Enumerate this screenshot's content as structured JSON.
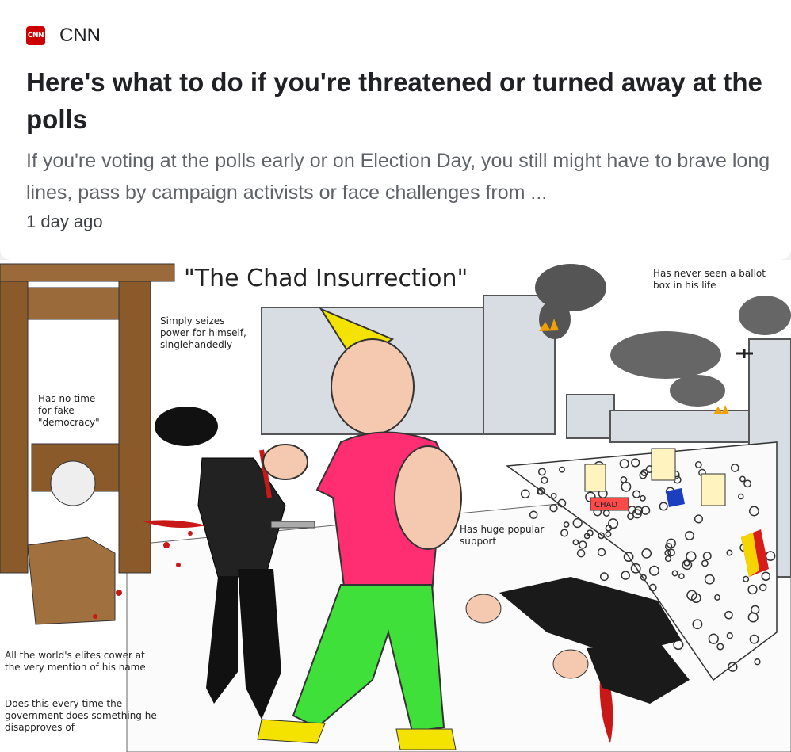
{
  "article": {
    "source": "CNN",
    "source_logo_text": "CNN",
    "headline": "Here's what to do if you're threatened or turned away at the polls",
    "snippet": "If you're voting at the polls early or on Election Day, you still might have to brave long lines, pass by campaign activists or face challenges from ...",
    "time": "1 day ago"
  },
  "meme": {
    "title": "\"The Chad Insurrection\"",
    "captions": {
      "ballot": "Has never seen a ballot\nbox in his life",
      "seizes": "Simply seizes\npower for himself,\nsinglehandedly",
      "democracy": "Has no time\nfor fake\n\"democracy\"",
      "support": "Has huge popular\nsupport",
      "elites": "All the world's elites cower at\nthe very mention of his name",
      "government": "Does this every time the\ngovernment does something he\ndisapproves of"
    },
    "sign_text": "CHAD"
  }
}
